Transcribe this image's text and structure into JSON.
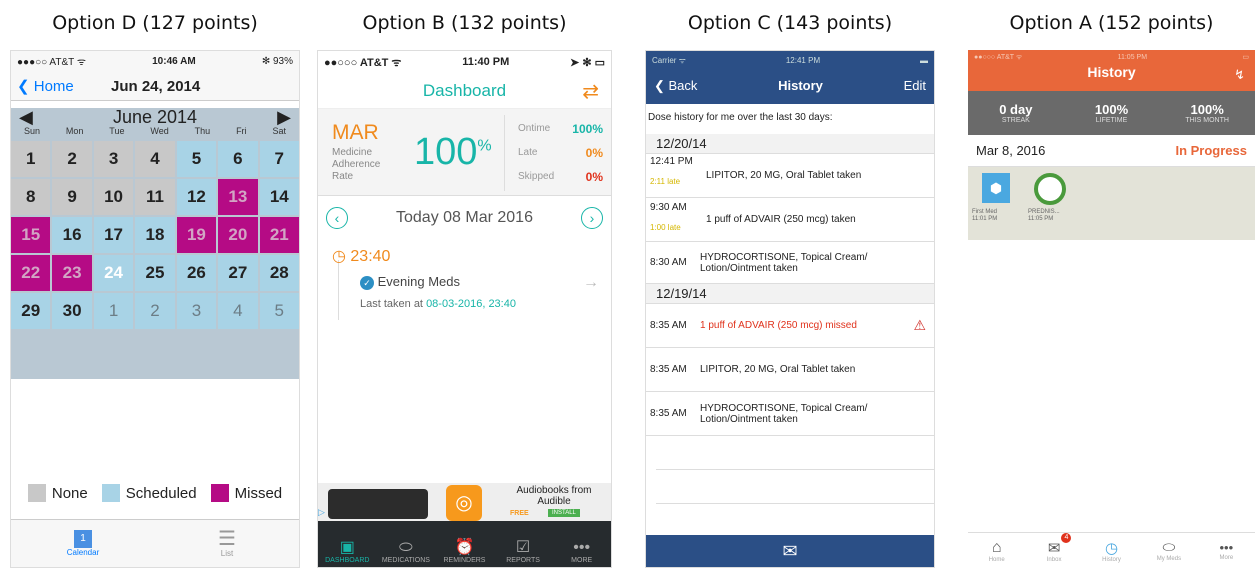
{
  "captions": {
    "d": "Option D (127 points)",
    "b": "Option B (132 points)",
    "c": "Option C (143 points)",
    "a": "Option A (152 points)"
  },
  "d": {
    "carrier": "●●●○○ AT&T ᯤ",
    "time": "10:46 AM",
    "battery": "✻ 93%",
    "back": "Home",
    "title": "Jun 24, 2014",
    "month": "June 2014",
    "weekdays": [
      "Sun",
      "Mon",
      "Tue",
      "Wed",
      "Thu",
      "Fri",
      "Sat"
    ],
    "days": [
      [
        "1",
        "n"
      ],
      [
        "2",
        "n"
      ],
      [
        "3",
        "n"
      ],
      [
        "4",
        "n"
      ],
      [
        "5",
        "s"
      ],
      [
        "6",
        "s"
      ],
      [
        "7",
        "s"
      ],
      [
        "8",
        "n"
      ],
      [
        "9",
        "n"
      ],
      [
        "10",
        "n"
      ],
      [
        "11",
        "n"
      ],
      [
        "12",
        "s"
      ],
      [
        "13",
        "m"
      ],
      [
        "14",
        "s"
      ],
      [
        "15",
        "m"
      ],
      [
        "16",
        "s"
      ],
      [
        "17",
        "s"
      ],
      [
        "18",
        "s"
      ],
      [
        "19",
        "m"
      ],
      [
        "20",
        "m"
      ],
      [
        "21",
        "m"
      ],
      [
        "22",
        "m"
      ],
      [
        "23",
        "m"
      ],
      [
        "24",
        "t"
      ],
      [
        "25",
        "s"
      ],
      [
        "26",
        "s"
      ],
      [
        "27",
        "s"
      ],
      [
        "28",
        "s"
      ],
      [
        "29",
        "s"
      ],
      [
        "30",
        "s"
      ],
      [
        "1",
        "o"
      ],
      [
        "2",
        "o"
      ],
      [
        "3",
        "o"
      ],
      [
        "4",
        "o"
      ],
      [
        "5",
        "o"
      ]
    ],
    "legend": {
      "none": "None",
      "scheduled": "Scheduled",
      "missed": "Missed"
    },
    "tab_calendar": "Calendar",
    "tab_list": "List",
    "tab_calendar_date": "1"
  },
  "b": {
    "carrier": "●●○○○ AT&T ᯤ",
    "time": "11:40 PM",
    "title": "Dashboard",
    "mar": "MAR",
    "mar_sub": "Medicine Adherence Rate",
    "pct": "100",
    "pct_sign": "%",
    "ontime_l": "Ontime",
    "ontime_v": "100%",
    "late_l": "Late",
    "late_v": "0%",
    "skipped_l": "Skipped",
    "skipped_v": "0%",
    "date": "Today  08 Mar 2016",
    "dose_time": "23:40",
    "dose_name": "Evening Meds",
    "last_taken_l": "Last taken at",
    "last_taken_v": "08-03-2016, 23:40",
    "ad_text": "Audiobooks from Audible",
    "ad_free": "FREE",
    "ad_install": "INSTALL",
    "ad_mark": "▷",
    "tabs": [
      "DASHBOARD",
      "MEDICATIONS",
      "REMINDERS",
      "REPORTS",
      "MORE"
    ]
  },
  "c": {
    "carrier": "Carrier ᯤ",
    "time": "12:41 PM",
    "back": "Back",
    "title": "History",
    "edit": "Edit",
    "intro": "Dose history for me over the last 30 days:",
    "d1": "12/20/14",
    "r1_time": "12:41 PM",
    "r1_text": "LIPITOR, 20 MG, Oral Tablet taken",
    "r1_late": "2:11 late",
    "r2_time": "9:30 AM",
    "r2_text": "1 puff of ADVAIR (250 mcg) taken",
    "r2_late": "1:00 late",
    "r3_time": "8:30 AM",
    "r3_text": "HYDROCORTISONE, Topical Cream/ Lotion/Ointment taken",
    "d2": "12/19/14",
    "r4_time": "8:35 AM",
    "r4_text": "1 puff of ADVAIR (250 mcg) missed",
    "r5_time": "8:35 AM",
    "r5_text": "LIPITOR, 20 MG, Oral Tablet taken",
    "r6_time": "8:35 AM",
    "r6_text": "HYDROCORTISONE, Topical Cream/ Lotion/Ointment taken"
  },
  "a": {
    "carrier": "●●○○○ AT&T ᯤ",
    "time": "11:05 PM",
    "title": "History",
    "s1": "0 day",
    "s1l": "STREAK",
    "s2": "100%",
    "s2l": "LIFETIME",
    "s3": "100%",
    "s3l": "THIS MONTH",
    "date": "Mar 8, 2016",
    "status": "In Progress",
    "m1": "First Med",
    "m1t": "11:01 PM",
    "m2": "PREDNIS...",
    "m2t": "11:05 PM",
    "badge": "4",
    "tabs": [
      "Home",
      "Inbox",
      "History",
      "My Meds",
      "More"
    ]
  },
  "colors": {
    "teal": "#18b5a8",
    "orange": "#e8673a",
    "navy": "#2b4f86",
    "magenta": "#b50b85",
    "blue": "#007aff"
  }
}
